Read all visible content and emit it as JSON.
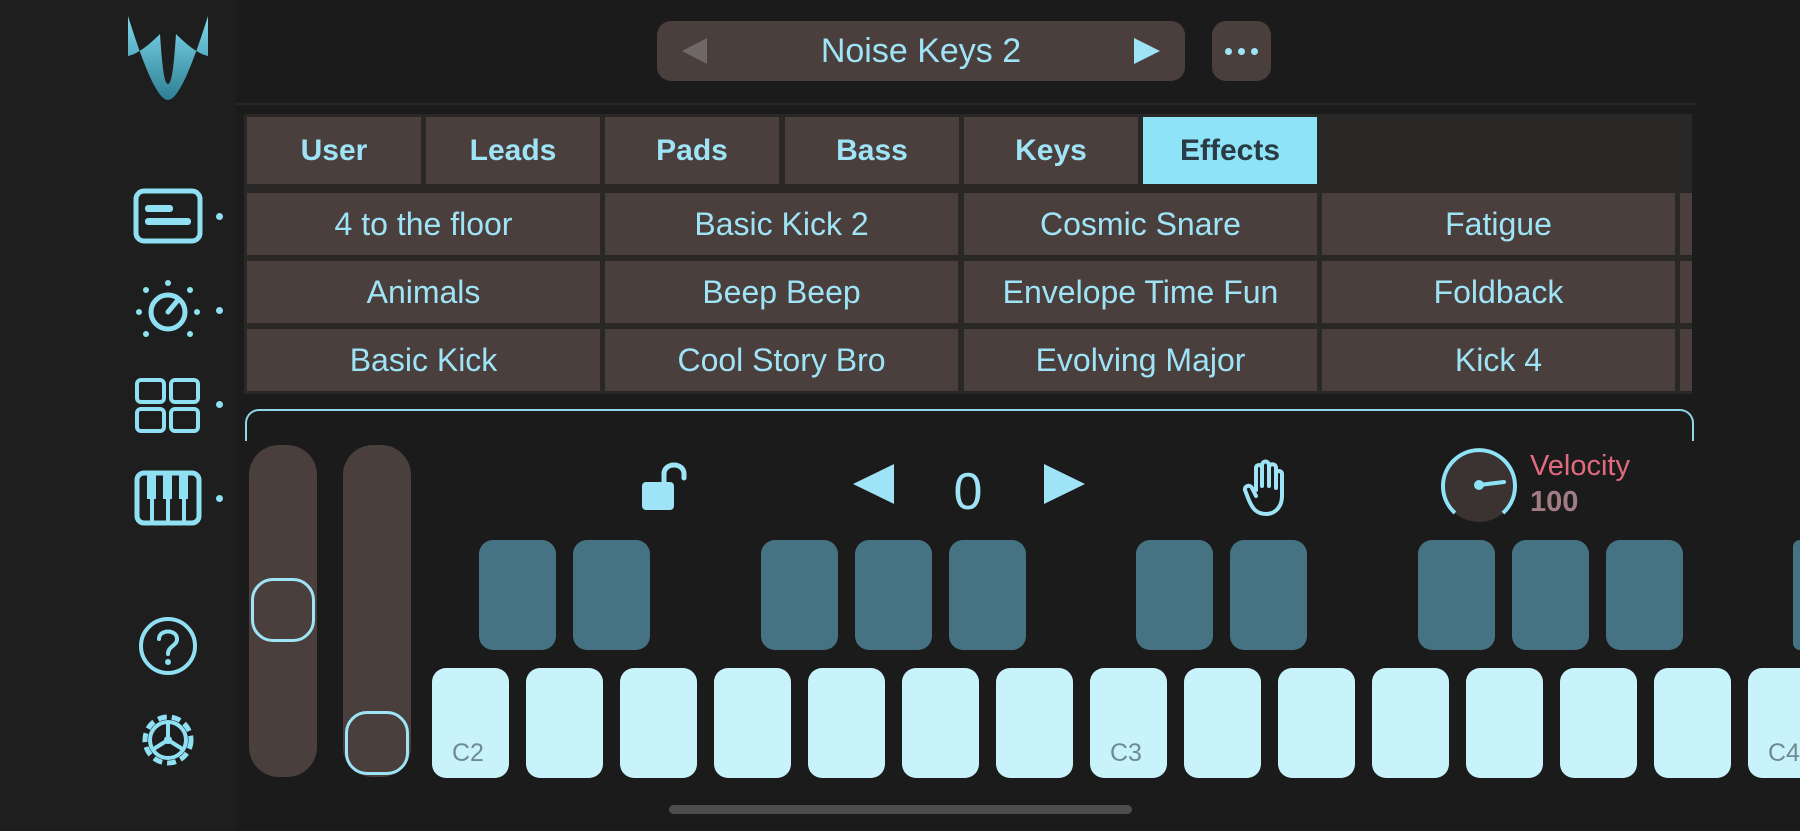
{
  "preset": {
    "name": "Noise Keys 2",
    "prev_icon": "triangle-left-icon",
    "next_icon": "triangle-right-icon"
  },
  "more_menu": {
    "icon": "ellipsis-icon"
  },
  "sidebar": {
    "logo": "wave-logo",
    "items": [
      {
        "name": "preset-browser",
        "icon": "browser-panel-icon"
      },
      {
        "name": "parameters",
        "icon": "knob-icon"
      },
      {
        "name": "pads",
        "icon": "grid-icon"
      },
      {
        "name": "keyboard",
        "icon": "piano-icon"
      }
    ],
    "help_icon": "question-icon",
    "settings_icon": "gear-icon"
  },
  "tabs": [
    {
      "label": "User",
      "active": false
    },
    {
      "label": "Leads",
      "active": false
    },
    {
      "label": "Pads",
      "active": false
    },
    {
      "label": "Bass",
      "active": false
    },
    {
      "label": "Keys",
      "active": false
    },
    {
      "label": "Effects",
      "active": true
    }
  ],
  "presets_grid": [
    [
      "4 to the floor",
      "Basic Kick 2",
      "Cosmic Snare",
      "Fatigue"
    ],
    [
      "Animals",
      "Beep Beep",
      "Envelope Time Fun",
      "Foldback"
    ],
    [
      "Basic Kick",
      "Cool Story Bro",
      "Evolving Major",
      "Kick 4"
    ]
  ],
  "keyboard_controls": {
    "lock_icon": "unlock-icon",
    "octave_prev_icon": "triangle-left-icon",
    "octave_value": "0",
    "octave_next_icon": "triangle-right-icon",
    "hold_icon": "hand-icon",
    "velocity_label": "Velocity",
    "velocity_value": "100"
  },
  "keyboard": {
    "labels": [
      "C2",
      "C3",
      "C4"
    ]
  },
  "colors": {
    "accent": "#8ee3f7",
    "panel": "#4a3f3d",
    "velocity": "#e26a7e",
    "pad": "#467384",
    "key": "#c9f3fb"
  }
}
